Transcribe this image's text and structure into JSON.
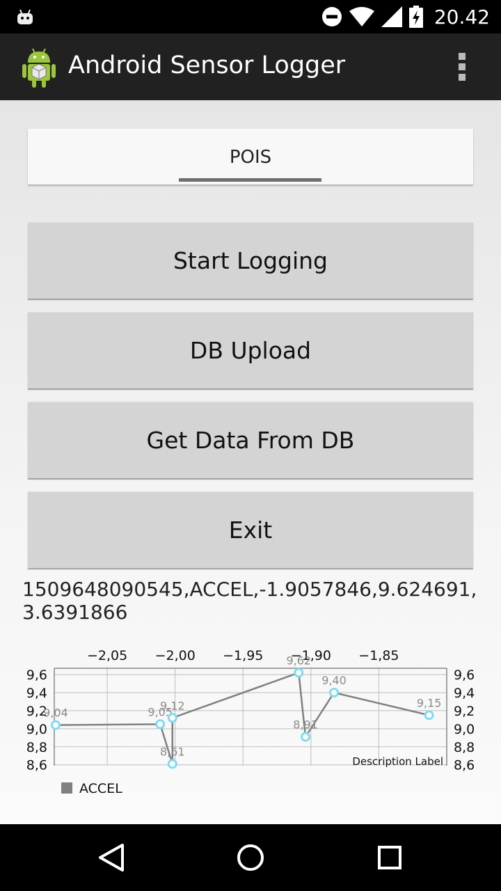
{
  "status_bar": {
    "time": "20.42"
  },
  "app": {
    "title": "Android Sensor Logger"
  },
  "tabs": [
    {
      "label": "POIS"
    }
  ],
  "buttons": {
    "start_logging": "Start Logging",
    "db_upload": "DB Upload",
    "get_data": "Get Data From DB",
    "exit": "Exit"
  },
  "sensor_reading": "1509648090545,ACCEL,-1.9057846,9.624691,3.6391866",
  "chart_data": {
    "type": "line",
    "description": "Description Label",
    "x_ticks": [
      "−2,05",
      "−2,00",
      "−1,95",
      "−1,90",
      "−1,85"
    ],
    "x_tick_values": [
      -2.05,
      -2.0,
      -1.95,
      -1.9,
      -1.85
    ],
    "y_ticks": [
      "9,6",
      "9,4",
      "9,2",
      "9,0",
      "8,8",
      "8,6"
    ],
    "y_tick_values": [
      9.6,
      9.4,
      9.2,
      9.0,
      8.8,
      8.6
    ],
    "xlim": [
      -2.089,
      -1.8
    ],
    "ylim": [
      8.59,
      9.67
    ],
    "grid": true,
    "legend": "bottom-left",
    "series": [
      {
        "name": "ACCEL",
        "color": "#808080",
        "marker_color": "#7fdcf0",
        "x": [
          -2.088,
          -2.011,
          -2.002,
          -2.002,
          -1.909,
          -1.904,
          -1.883,
          -1.813
        ],
        "y": [
          9.04,
          9.05,
          8.61,
          9.12,
          9.62,
          8.91,
          9.4,
          9.15
        ],
        "labels": [
          "9,04",
          "9,05",
          "8,61",
          "9,12",
          "9,62",
          "8,91",
          "9,40",
          "9,15"
        ]
      }
    ]
  }
}
